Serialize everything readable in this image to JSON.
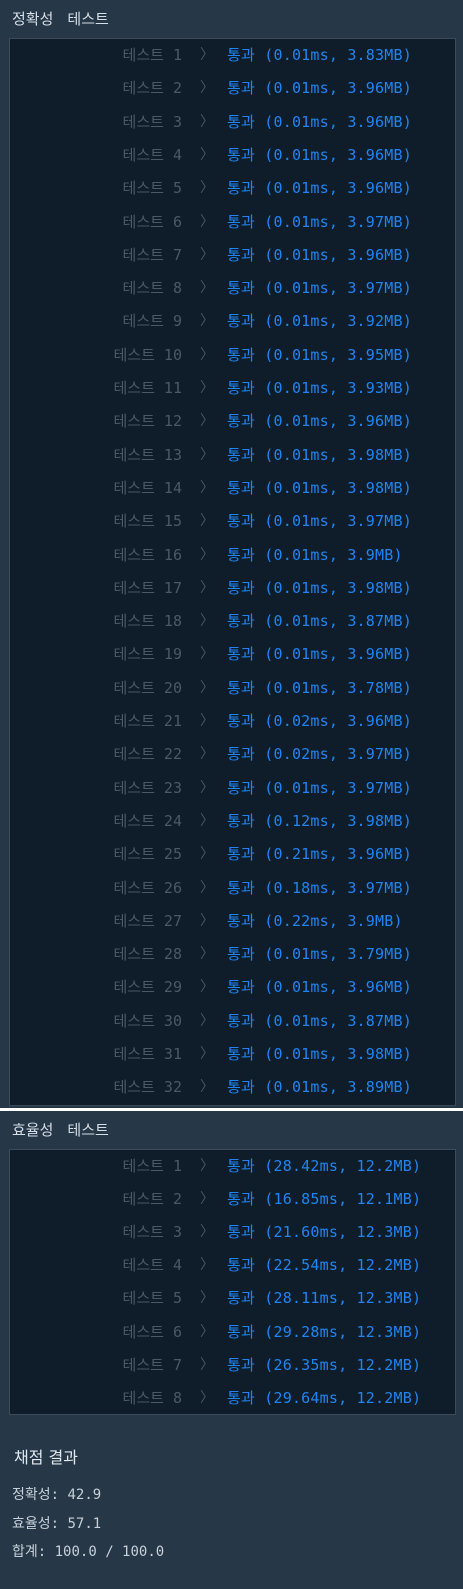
{
  "accuracy": {
    "header": "정확성",
    "header_suffix": "테스트",
    "tests": [
      {
        "label": "테스트 1",
        "status": "통과",
        "detail": "(0.01ms, 3.83MB)"
      },
      {
        "label": "테스트 2",
        "status": "통과",
        "detail": "(0.01ms, 3.96MB)"
      },
      {
        "label": "테스트 3",
        "status": "통과",
        "detail": "(0.01ms, 3.96MB)"
      },
      {
        "label": "테스트 4",
        "status": "통과",
        "detail": "(0.01ms, 3.96MB)"
      },
      {
        "label": "테스트 5",
        "status": "통과",
        "detail": "(0.01ms, 3.96MB)"
      },
      {
        "label": "테스트 6",
        "status": "통과",
        "detail": "(0.01ms, 3.97MB)"
      },
      {
        "label": "테스트 7",
        "status": "통과",
        "detail": "(0.01ms, 3.96MB)"
      },
      {
        "label": "테스트 8",
        "status": "통과",
        "detail": "(0.01ms, 3.97MB)"
      },
      {
        "label": "테스트 9",
        "status": "통과",
        "detail": "(0.01ms, 3.92MB)"
      },
      {
        "label": "테스트 10",
        "status": "통과",
        "detail": "(0.01ms, 3.95MB)"
      },
      {
        "label": "테스트 11",
        "status": "통과",
        "detail": "(0.01ms, 3.93MB)"
      },
      {
        "label": "테스트 12",
        "status": "통과",
        "detail": "(0.01ms, 3.96MB)"
      },
      {
        "label": "테스트 13",
        "status": "통과",
        "detail": "(0.01ms, 3.98MB)"
      },
      {
        "label": "테스트 14",
        "status": "통과",
        "detail": "(0.01ms, 3.98MB)"
      },
      {
        "label": "테스트 15",
        "status": "통과",
        "detail": "(0.01ms, 3.97MB)"
      },
      {
        "label": "테스트 16",
        "status": "통과",
        "detail": "(0.01ms, 3.9MB)"
      },
      {
        "label": "테스트 17",
        "status": "통과",
        "detail": "(0.01ms, 3.98MB)"
      },
      {
        "label": "테스트 18",
        "status": "통과",
        "detail": "(0.01ms, 3.87MB)"
      },
      {
        "label": "테스트 19",
        "status": "통과",
        "detail": "(0.01ms, 3.96MB)"
      },
      {
        "label": "테스트 20",
        "status": "통과",
        "detail": "(0.01ms, 3.78MB)"
      },
      {
        "label": "테스트 21",
        "status": "통과",
        "detail": "(0.02ms, 3.96MB)"
      },
      {
        "label": "테스트 22",
        "status": "통과",
        "detail": "(0.02ms, 3.97MB)"
      },
      {
        "label": "테스트 23",
        "status": "통과",
        "detail": "(0.01ms, 3.97MB)"
      },
      {
        "label": "테스트 24",
        "status": "통과",
        "detail": "(0.12ms, 3.98MB)"
      },
      {
        "label": "테스트 25",
        "status": "통과",
        "detail": "(0.21ms, 3.96MB)"
      },
      {
        "label": "테스트 26",
        "status": "통과",
        "detail": "(0.18ms, 3.97MB)"
      },
      {
        "label": "테스트 27",
        "status": "통과",
        "detail": "(0.22ms, 3.9MB)"
      },
      {
        "label": "테스트 28",
        "status": "통과",
        "detail": "(0.01ms, 3.79MB)"
      },
      {
        "label": "테스트 29",
        "status": "통과",
        "detail": "(0.01ms, 3.96MB)"
      },
      {
        "label": "테스트 30",
        "status": "통과",
        "detail": "(0.01ms, 3.87MB)"
      },
      {
        "label": "테스트 31",
        "status": "통과",
        "detail": "(0.01ms, 3.98MB)"
      },
      {
        "label": "테스트 32",
        "status": "통과",
        "detail": "(0.01ms, 3.89MB)"
      }
    ]
  },
  "efficiency": {
    "header": "효율성",
    "header_suffix": "테스트",
    "tests": [
      {
        "label": "테스트 1",
        "status": "통과",
        "detail": "(28.42ms, 12.2MB)"
      },
      {
        "label": "테스트 2",
        "status": "통과",
        "detail": "(16.85ms, 12.1MB)"
      },
      {
        "label": "테스트 3",
        "status": "통과",
        "detail": "(21.60ms, 12.3MB)"
      },
      {
        "label": "테스트 4",
        "status": "통과",
        "detail": "(22.54ms, 12.2MB)"
      },
      {
        "label": "테스트 5",
        "status": "통과",
        "detail": "(28.11ms, 12.3MB)"
      },
      {
        "label": "테스트 6",
        "status": "통과",
        "detail": "(29.28ms, 12.3MB)"
      },
      {
        "label": "테스트 7",
        "status": "통과",
        "detail": "(26.35ms, 12.2MB)"
      },
      {
        "label": "테스트 8",
        "status": "통과",
        "detail": "(29.64ms, 12.2MB)"
      }
    ]
  },
  "score": {
    "title": "채점 결과",
    "accuracy": "정확성: 42.9",
    "efficiency": "효율성: 57.1",
    "total": "합계: 100.0 / 100.0"
  },
  "colors": {
    "pass": "#1f85f2",
    "label": "#4a5867",
    "box_bg": "#0f1d2a",
    "page_bg": "#263747"
  },
  "icons": {
    "row_separator": "chevron-right-icon"
  }
}
